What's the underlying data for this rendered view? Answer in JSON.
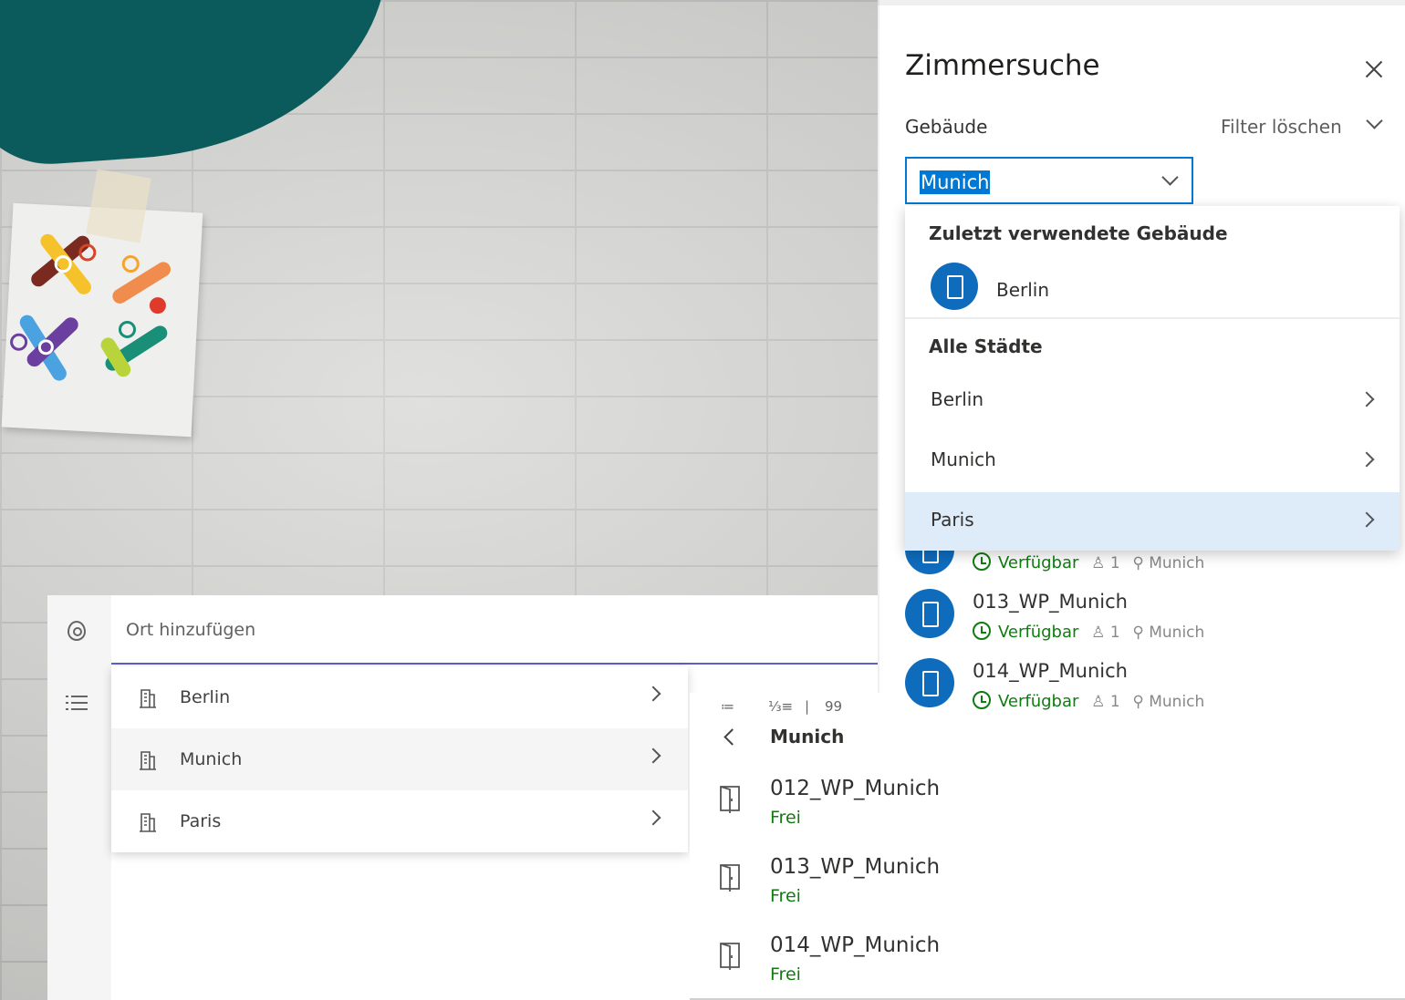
{
  "location_picker": {
    "placeholder": "Ort hinzufügen",
    "items": [
      {
        "label": "Berlin"
      },
      {
        "label": "Munich"
      },
      {
        "label": "Paris"
      }
    ]
  },
  "room_list": {
    "toolbar": {
      "list_icon": "≔",
      "numbered_icon": "⅓≡",
      "divider": "|",
      "quote": "99"
    },
    "header": "Munich",
    "rooms": [
      {
        "name": "012_WP_Munich",
        "status": "Frei"
      },
      {
        "name": "013_WP_Munich",
        "status": "Frei"
      },
      {
        "name": "014_WP_Munich",
        "status": "Frei"
      }
    ]
  },
  "zimmersuche": {
    "title": "Zimmersuche",
    "building_label": "Gebäude",
    "filter_clear": "Filter löschen",
    "combo_value": "Munich",
    "flyout": {
      "recent_heading": "Zuletzt verwendete Gebäude",
      "recent_item": "Berlin",
      "all_heading": "Alle Städte",
      "cities": [
        {
          "label": "Berlin"
        },
        {
          "label": "Munich"
        },
        {
          "label": "Paris"
        }
      ]
    },
    "rooms": [
      {
        "name": "",
        "availability": "Verfügbar",
        "capacity": "1",
        "location": "Munich"
      },
      {
        "name": "013_WP_Munich",
        "availability": "Verfügbar",
        "capacity": "1",
        "location": "Munich"
      },
      {
        "name": "014_WP_Munich",
        "availability": "Verfügbar",
        "capacity": "1",
        "location": "Munich"
      }
    ]
  },
  "colors": {
    "teal_blob": "#0b5a5c",
    "accent_blue": "#0078d4",
    "teams_purple": "#5b5fc7",
    "available_green": "#107c10",
    "selected_row": "#deecf9"
  }
}
